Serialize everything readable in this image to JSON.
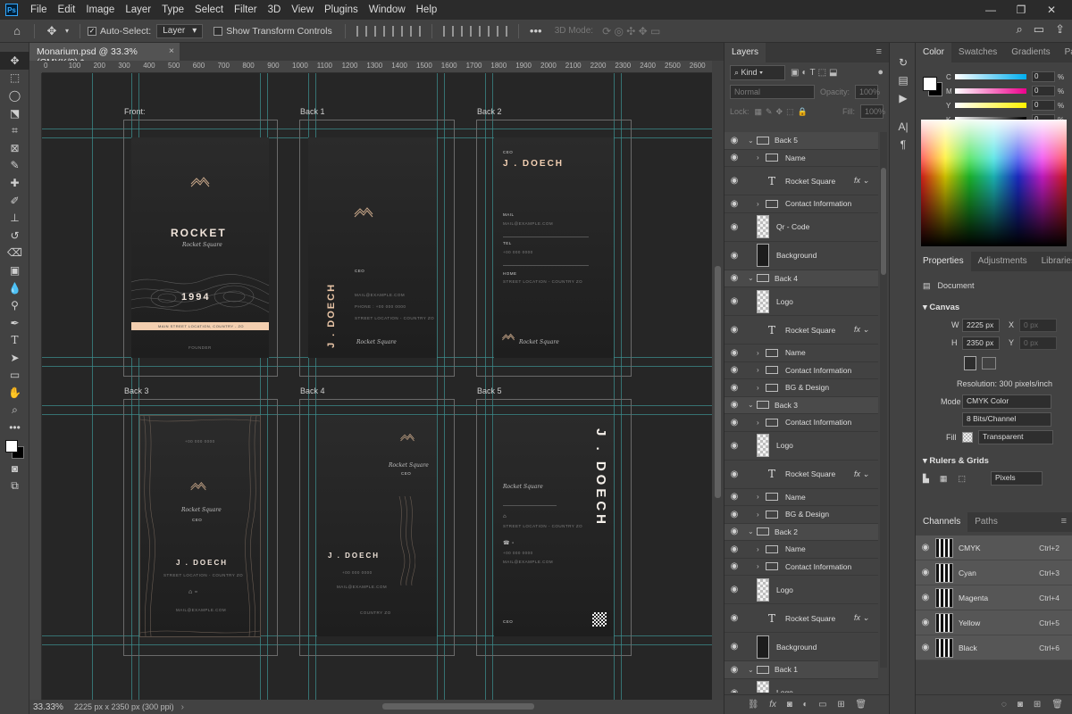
{
  "menu": [
    "File",
    "Edit",
    "Image",
    "Layer",
    "Type",
    "Select",
    "Filter",
    "3D",
    "View",
    "Plugins",
    "Window",
    "Help"
  ],
  "options": {
    "auto_select_label": "Auto-Select:",
    "auto_select_value": "Layer",
    "transform_label": "Show Transform Controls",
    "mode_3d": "3D Mode:"
  },
  "document": {
    "tab_title": "Monarium.psd @ 33.3% (CMYK/8) *",
    "ruler_ticks": [
      "0",
      "100",
      "200",
      "300",
      "400",
      "500",
      "600",
      "700",
      "800",
      "900",
      "1000",
      "1100",
      "1200",
      "1300",
      "1400",
      "1500",
      "1600",
      "1700",
      "1800",
      "1900",
      "2000",
      "2100",
      "2200",
      "2300",
      "2400",
      "2500",
      "2600"
    ],
    "zoom": "33.33%",
    "status": "2225 px x 2350 px (300 ppi)"
  },
  "artboards": {
    "front_label": "Front",
    "back1_label": "Back 1",
    "back2_label": "Back 2",
    "back3_label": "Back 3",
    "back4_label": "Back 4",
    "back5_label": "Back 5"
  },
  "cards": {
    "rocket": "ROCKET",
    "rocket_square": "Rocket Square",
    "year": "1994",
    "address": "MAIN STREET LOCATION, COUNTRY - ZO",
    "founder": "FOUNDER",
    "ceo": "CEO",
    "name": "J . DOECH",
    "mail_label": "MAIL",
    "mail": "MAIL@EXAMPLE.COM",
    "tel_label": "TEL",
    "tel": "+00 000 0000",
    "home_label": "HOME",
    "street": "STREET LOCATION - COUNTRY ZO",
    "phone_line": "PHONE : +00 000 0000",
    "email_line": "MAIL@EXAMPLE.COM",
    "country": "COUNTRY ZO"
  },
  "layers_panel": {
    "tab": "Layers",
    "kind": "Kind",
    "blend": "Normal",
    "opacity_label": "Opacity:",
    "opacity": "100%",
    "lock_label": "Lock:",
    "fill_label": "Fill:",
    "fill": "100%",
    "rows": [
      {
        "name": "Back 5",
        "kind": "group",
        "open": true
      },
      {
        "name": "Name",
        "kind": "folder"
      },
      {
        "name": "Rocket Square",
        "kind": "text",
        "fx": true
      },
      {
        "name": "Contact Information",
        "kind": "folder"
      },
      {
        "name": "Qr - Code",
        "kind": "checker"
      },
      {
        "name": "Background",
        "kind": "solid"
      },
      {
        "name": "Back 4",
        "kind": "group",
        "open": true
      },
      {
        "name": "Logo",
        "kind": "checker"
      },
      {
        "name": "Rocket Square",
        "kind": "text",
        "fx": true
      },
      {
        "name": "Name",
        "kind": "folder"
      },
      {
        "name": "Contact Information",
        "kind": "folder"
      },
      {
        "name": "BG & Design",
        "kind": "folder"
      },
      {
        "name": "Back 3",
        "kind": "group",
        "open": true
      },
      {
        "name": "Contact Information",
        "kind": "folder"
      },
      {
        "name": "Logo",
        "kind": "checker"
      },
      {
        "name": "Rocket Square",
        "kind": "text",
        "fx": true
      },
      {
        "name": "Name",
        "kind": "folder"
      },
      {
        "name": "BG & Design",
        "kind": "folder"
      },
      {
        "name": "Back 2",
        "kind": "group",
        "open": true
      },
      {
        "name": "Name",
        "kind": "folder"
      },
      {
        "name": "Contact Information",
        "kind": "folder"
      },
      {
        "name": "Logo",
        "kind": "checker"
      },
      {
        "name": "Rocket Square",
        "kind": "text",
        "fx": true
      },
      {
        "name": "Background",
        "kind": "solid"
      },
      {
        "name": "Back 1",
        "kind": "group",
        "open": true
      },
      {
        "name": "Logo",
        "kind": "checker"
      }
    ]
  },
  "color_panel": {
    "tabs": [
      "Color",
      "Swatches",
      "Gradients",
      "Patterns"
    ],
    "channels": [
      {
        "label": "C",
        "value": "0",
        "gradient": "linear-gradient(90deg,#fff,#00aeef)"
      },
      {
        "label": "M",
        "value": "0",
        "gradient": "linear-gradient(90deg,#fff,#ec008c)"
      },
      {
        "label": "Y",
        "value": "0",
        "gradient": "linear-gradient(90deg,#fff,#fff200)"
      },
      {
        "label": "K",
        "value": "0",
        "gradient": "linear-gradient(90deg,#fff,#000)"
      }
    ],
    "pct": "%"
  },
  "properties": {
    "tabs": [
      "Properties",
      "Adjustments",
      "Libraries"
    ],
    "document": "Document",
    "canvas": "Canvas",
    "w_label": "W",
    "w": "2225 px",
    "h_label": "H",
    "h": "2350 px",
    "x_label": "X",
    "x_ph": "0 px",
    "y_label": "Y",
    "y_ph": "0 px",
    "resolution": "Resolution: 300 pixels/inch",
    "mode_label": "Mode",
    "mode": "CMYK Color",
    "bits": "8 Bits/Channel",
    "fill_label": "Fill",
    "fill": "Transparent",
    "rulers_grids": "Rulers & Grids",
    "units": "Pixels"
  },
  "channels": {
    "tabs": [
      "Channels",
      "Paths"
    ],
    "rows": [
      {
        "name": "CMYK",
        "key": "Ctrl+2"
      },
      {
        "name": "Cyan",
        "key": "Ctrl+3"
      },
      {
        "name": "Magenta",
        "key": "Ctrl+4"
      },
      {
        "name": "Yellow",
        "key": "Ctrl+5"
      },
      {
        "name": "Black",
        "key": "Ctrl+6"
      }
    ]
  }
}
